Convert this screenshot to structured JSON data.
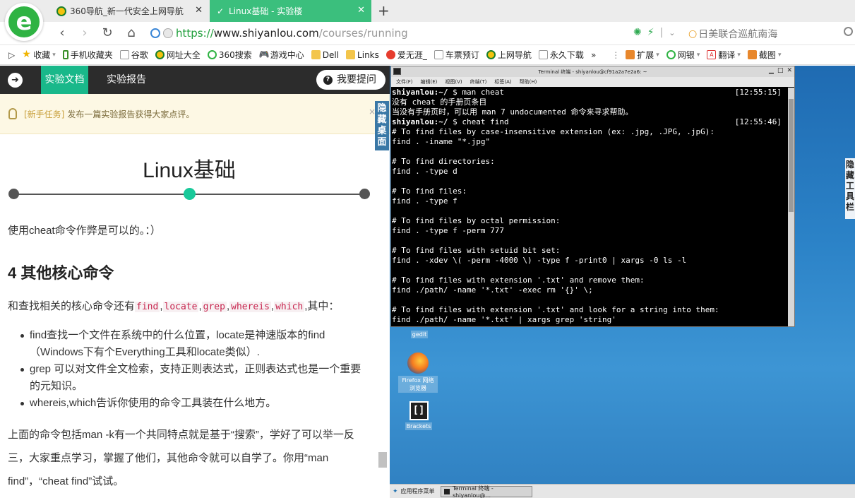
{
  "browser": {
    "tabs": [
      {
        "label": "360导航_新一代安全上网导航",
        "active": false
      },
      {
        "label": "Linux基础 - 实验楼",
        "active": true
      }
    ],
    "new_tab": "+",
    "url": {
      "protocol": "https://",
      "host": "www.shiyanlou.com",
      "path": "/courses/running"
    },
    "news_ticker": "日美联合巡航南海",
    "bookmarks": [
      {
        "label": "收藏",
        "icon": "star-icon",
        "dropdown": true
      },
      {
        "label": "手机收藏夹",
        "icon": "phone-icon"
      },
      {
        "label": "谷歌",
        "icon": "page-icon"
      },
      {
        "label": "网址大全",
        "icon": "360-icon"
      },
      {
        "label": "360搜索",
        "icon": "search-icon"
      },
      {
        "label": "游戏中心",
        "icon": "gamepad-icon"
      },
      {
        "label": "Dell",
        "icon": "folder-icon"
      },
      {
        "label": "Links",
        "icon": "folder-icon"
      },
      {
        "label": "爱无涯_",
        "icon": "heart-icon"
      },
      {
        "label": "车票预订",
        "icon": "page-icon"
      },
      {
        "label": "上网导航",
        "icon": "360-icon"
      },
      {
        "label": "永久下载",
        "icon": "page-icon"
      }
    ],
    "more": "»",
    "tools": [
      {
        "label": "扩展",
        "icon": "puzzle-icon"
      },
      {
        "label": "网银",
        "icon": "bank-icon"
      },
      {
        "label": "翻译",
        "icon": "translate-icon"
      },
      {
        "label": "截图",
        "icon": "scissors-icon"
      }
    ]
  },
  "lab": {
    "tab_docs": "实验文档",
    "tab_report": "实验报告",
    "ask_button": "我要提问",
    "notice_tag": "[新手任务]",
    "notice_text": "发布一篇实验报告获得大家点评。",
    "notice_close": "×",
    "hide_desktop": "隐藏桌面",
    "course_title": "Linux基础",
    "progress": {
      "steps": 3,
      "current_step": 2
    },
    "para1": "使用cheat命令作弊是可以的。：）",
    "heading": "4 其他核心命令",
    "para2_prefix": "和查找相关的核心命令还有",
    "para2_codes": [
      "find",
      "locate",
      "grep",
      "whereis",
      "which"
    ],
    "para2_suffix": ",其中：",
    "bullets": [
      "find查找一个文件在系统中的什么位置，locate是神速版本的find（Windows下有个Everything工具和locate类似）.",
      "grep 可以对文件全文检索，支持正则表达式，正则表达式也是一个重要的元知识。",
      "whereis,which告诉你使用的命令工具装在什么地方。"
    ],
    "para3": "上面的命令包括man -k有一个共同特点就是基于“搜索”，学好了可以举一反三，大家重点学习，掌握了他们，其他命令就可以自学了。你用“man find”，“cheat find”试试。"
  },
  "terminal": {
    "title": "Terminal 终端 - shiyanlou@cf91a2a7e2a6: ~",
    "menu": [
      "文件(F)",
      "编辑(E)",
      "视图(V)",
      "终端(T)",
      "标签(A)",
      "帮助(H)"
    ],
    "lines": [
      {
        "prompt": "shiyanlou:~/",
        "cmd": " $ man cheat",
        "time": "[12:55:15]"
      },
      {
        "text": "没有 cheat 的手册页条目"
      },
      {
        "text": "当没有手册页时，可以用 man 7 undocumented 命令来寻求帮助。"
      },
      {
        "prompt": "shiyanlou:~/",
        "cmd": " $ cheat find",
        "time": "[12:55:46]"
      },
      {
        "text": "# To find files by case-insensitive extension (ex: .jpg, .JPG, .jpG):"
      },
      {
        "text": "find . -iname \"*.jpg\""
      },
      {
        "text": ""
      },
      {
        "text": "# To find directories:"
      },
      {
        "text": "find . -type d"
      },
      {
        "text": ""
      },
      {
        "text": "# To find files:"
      },
      {
        "text": "find . -type f"
      },
      {
        "text": ""
      },
      {
        "text": "# To find files by octal permission:"
      },
      {
        "text": "find . -type f -perm 777"
      },
      {
        "text": ""
      },
      {
        "text": "# To find files with setuid bit set:"
      },
      {
        "text": "find . -xdev \\( -perm -4000 \\) -type f -print0 | xargs -0 ls -l"
      },
      {
        "text": ""
      },
      {
        "text": "# To find files with extension '.txt' and remove them:"
      },
      {
        "text": "find ./path/ -name '*.txt' -exec rm '{}' \\;"
      },
      {
        "text": ""
      },
      {
        "text": "# To find files with extension '.txt' and look for a string into them:"
      },
      {
        "text": "find ./path/ -name '*.txt' | xargs grep 'string'"
      }
    ]
  },
  "desktop": {
    "icons": [
      {
        "label": "gedit",
        "icon": "gedit-icon"
      },
      {
        "label": "Firefox 网络浏览器",
        "icon": "firefox-icon"
      },
      {
        "label": "Brackets",
        "icon": "brackets-icon"
      }
    ],
    "hide_toolbar": "隐藏工具栏",
    "taskbar": {
      "menu": "应用程序菜单",
      "window": "Terminal 终端 - shiyanlou@..."
    }
  }
}
